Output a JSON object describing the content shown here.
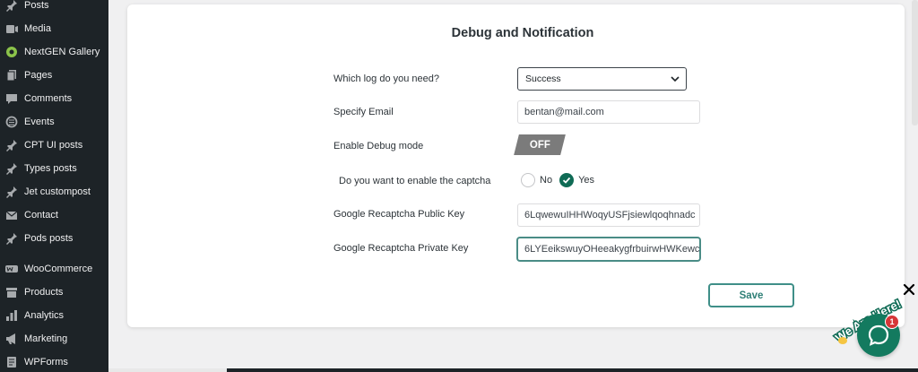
{
  "sidebar": {
    "items": [
      {
        "label": "Posts",
        "icon": "pin-icon"
      },
      {
        "label": "Media",
        "icon": "media-icon"
      },
      {
        "label": "NextGEN Gallery",
        "icon": "gallery-icon"
      },
      {
        "label": "Pages",
        "icon": "pages-icon"
      },
      {
        "label": "Comments",
        "icon": "comment-icon"
      },
      {
        "label": "Events",
        "icon": "events-icon"
      },
      {
        "label": "CPT UI posts",
        "icon": "pin-icon"
      },
      {
        "label": "Types posts",
        "icon": "pin-icon"
      },
      {
        "label": "Jet custompost",
        "icon": "pin-icon"
      },
      {
        "label": "Contact",
        "icon": "mail-icon"
      },
      {
        "label": "Pods posts",
        "icon": "pin-icon"
      },
      {
        "label": "WooCommerce",
        "icon": "woo-icon"
      },
      {
        "label": "Products",
        "icon": "archive-icon"
      },
      {
        "label": "Analytics",
        "icon": "chart-bar-icon"
      },
      {
        "label": "Marketing",
        "icon": "megaphone-icon"
      },
      {
        "label": "WPForms",
        "icon": "forms-icon"
      }
    ]
  },
  "panel": {
    "title": "Debug and Notification",
    "log_label": "Which log do you need?",
    "log_value": "Success",
    "email_label": "Specify Email",
    "email_value": "bentan@mail.com",
    "debug_label": "Enable Debug mode",
    "debug_state": "OFF",
    "captcha_label": "Do you want to enable the captcha",
    "captcha_no": "No",
    "captcha_yes": "Yes",
    "captcha_selected": "Yes",
    "public_key_label": "Google Recaptcha Public Key",
    "public_key_value": "6LqwewuIHHWoqyUSFjsiewlqoqhnadc",
    "private_key_label": "Google Recaptcha Private Key",
    "private_key_value": "6LYEeikswuyOHeeakygfrbuirwHWKewc",
    "save_label": "Save"
  },
  "chat": {
    "tagline": "We Are Here!",
    "badge_count": "1"
  },
  "colors": {
    "sidebar_bg": "#1d2327",
    "accent_green": "#0f6b55",
    "save_border": "#3f8f88",
    "toggle_off": "#7b7b7b",
    "badge_red": "#d63638"
  }
}
